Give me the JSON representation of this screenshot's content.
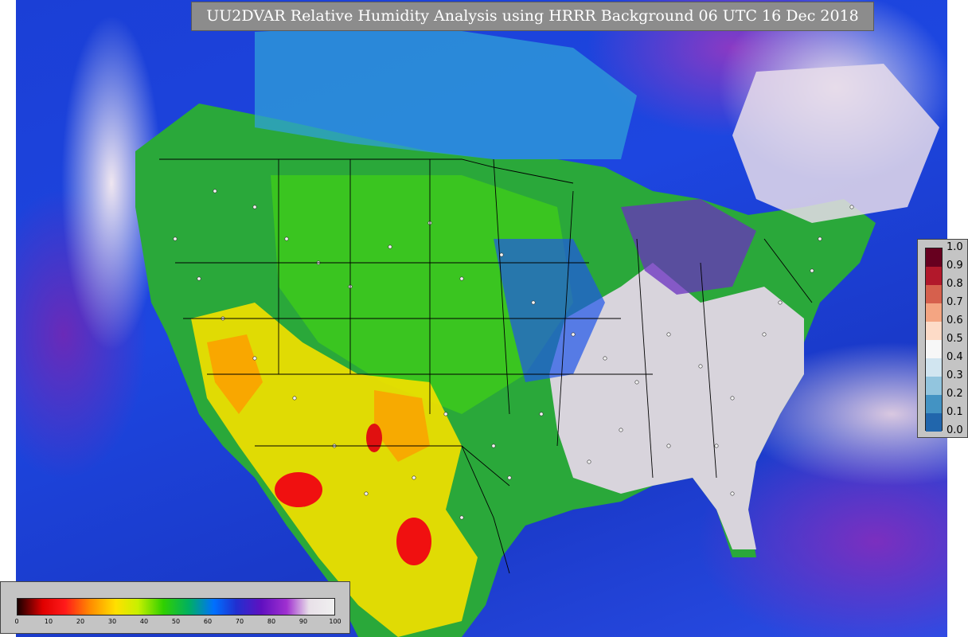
{
  "title": "UU2DVAR Relative Humidity Analysis using HRRR Background 06 UTC 16 Dec 2018",
  "obs_legend": {
    "ticks": [
      "1.0",
      "0.9",
      "0.8",
      "0.7",
      "0.6",
      "0.5",
      "0.4",
      "0.3",
      "0.2",
      "0.1",
      "0.0"
    ],
    "colors": [
      "#67001f",
      "#b2182b",
      "#d6604d",
      "#f4a582",
      "#fddbc7",
      "#f7f7f7",
      "#d1e5f0",
      "#92c5de",
      "#4393c3",
      "#2166ac",
      "#053061"
    ]
  },
  "rh_legend": {
    "ticks": [
      "0",
      "10",
      "20",
      "30",
      "40",
      "50",
      "60",
      "70",
      "80",
      "90",
      "100"
    ],
    "colors": [
      "#1a0000",
      "#e00000",
      "#ff1a1a",
      "#ff8c00",
      "#ffe000",
      "#c8f000",
      "#30d000",
      "#00b060",
      "#0070ff",
      "#2030d0",
      "#6010c0",
      "#a030d0",
      "#e8e0e8",
      "#f0f0f0"
    ]
  },
  "map_colors": {
    "ocean": "#1d46e0",
    "plains_green": "#3cc81e",
    "southwest_yellow": "#f0e000",
    "dry_red": "#f01010",
    "east_gray": "#d8d4dc",
    "great_lakes": "#6a30c0"
  }
}
